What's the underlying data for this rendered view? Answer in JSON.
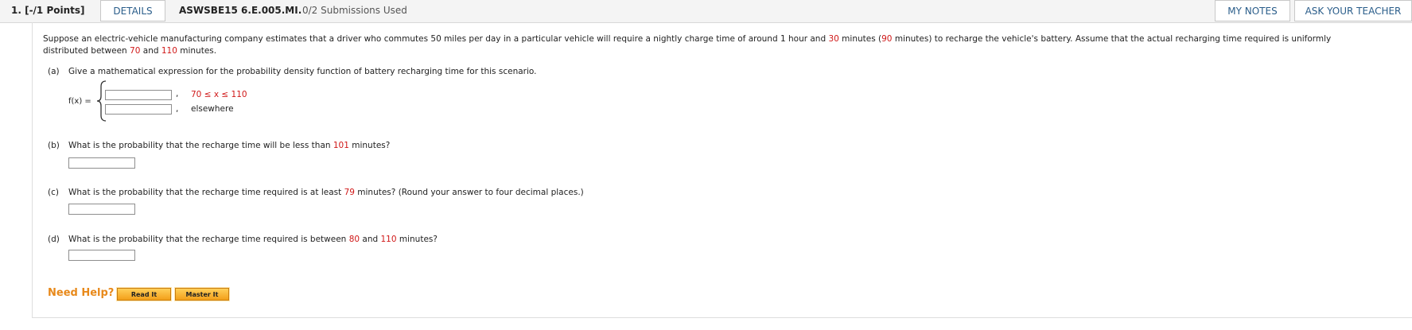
{
  "header": {
    "question_number": "1.  [-/1 Points]",
    "details_label": "DETAILS",
    "question_code": "ASWSBE15 6.E.005.MI.",
    "submissions": "0/2 Submissions Used",
    "my_notes_label": "MY NOTES",
    "ask_teacher_label": "ASK YOUR TEACHER"
  },
  "problem": {
    "intro_1a": "Suppose an electric-vehicle manufacturing company estimates that a driver who commutes 50 miles per day in a particular vehicle will require a nightly charge time of around 1 hour and ",
    "intro_1_v1": "30",
    "intro_1b": " minutes (",
    "intro_1_v2": "90",
    "intro_1c": " minutes) to recharge the vehicle's battery. Assume that the actual recharging time required is uniformly",
    "intro_2a": "distributed between ",
    "intro_2_v1": "70",
    "intro_2b": " and ",
    "intro_2_v2": "110",
    "intro_2c": " minutes."
  },
  "part_a": {
    "label": "(a)",
    "question": "Give a mathematical expression for the probability density function of battery recharging time for this scenario.",
    "fx_label": "f(x) =",
    "case1_answer": "",
    "case1_comma": ",",
    "case1_condition": "70 ≤ x ≤ 110",
    "case2_answer": "",
    "case2_comma": ",",
    "case2_condition": "elsewhere"
  },
  "part_b": {
    "label": "(b)",
    "question_a": "What is the probability that the recharge time will be less than ",
    "value": "101",
    "question_b": " minutes?",
    "answer": ""
  },
  "part_c": {
    "label": "(c)",
    "question_a": "What is the probability that the recharge time required is at least ",
    "value": "79",
    "question_b": " minutes? (Round your answer to four decimal places.)",
    "answer": ""
  },
  "part_d": {
    "label": "(d)",
    "question_a": "What is the probability that the recharge time required is between ",
    "value1": "80",
    "question_b": " and ",
    "value2": "110",
    "question_c": " minutes?",
    "answer": ""
  },
  "help": {
    "label": "Need Help?",
    "read_it": "Read It",
    "master_it": "Master It"
  },
  "colors": {
    "highlight": "#d01818",
    "link": "#2a5d8a",
    "help": "#e8891a"
  }
}
